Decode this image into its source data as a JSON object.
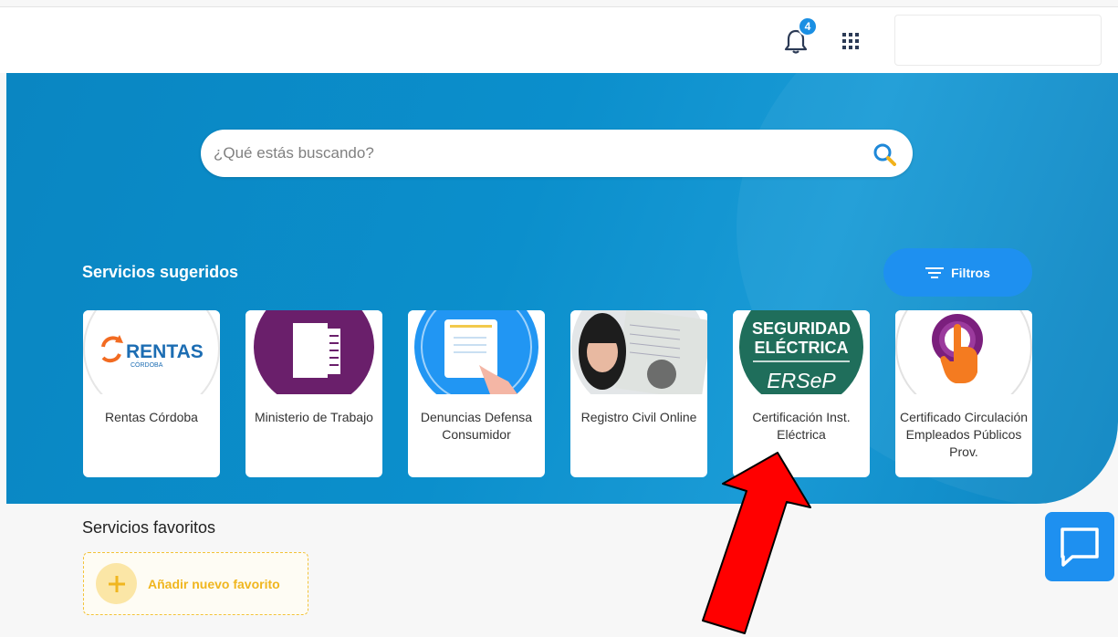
{
  "header": {
    "notifications_count": "4",
    "notifications_icon": "bell-icon",
    "apps_icon": "grid-apps-icon"
  },
  "search": {
    "placeholder": "¿Qué estás buscando?",
    "icon": "search-icon"
  },
  "suggested": {
    "title": "Servicios sugeridos",
    "filters_label": "Filtros",
    "cards": [
      {
        "label": "Rentas Córdoba",
        "logo_text": "RENTAS",
        "logo_sub": "CÓRDOBA"
      },
      {
        "label": "Ministerio de Trabajo"
      },
      {
        "label": "Denuncias Defensa Consumidor"
      },
      {
        "label": "Registro Civil Online"
      },
      {
        "label": "Certificación Inst. Eléctrica",
        "logo_line1": "SEGURIDAD",
        "logo_line2": "ELÉCTRICA",
        "logo_line3": "ERSeP"
      },
      {
        "label": "Certificado Circulación Empleados Públicos Prov."
      }
    ]
  },
  "favorites": {
    "title": "Servicios favoritos",
    "add_label": "Añadir nuevo favorito"
  },
  "colors": {
    "hero_blue": "#0b8fcc",
    "accent_blue": "#1e90f0",
    "favorite_yellow": "#f0b61f",
    "annotation_red": "#ff0000"
  }
}
